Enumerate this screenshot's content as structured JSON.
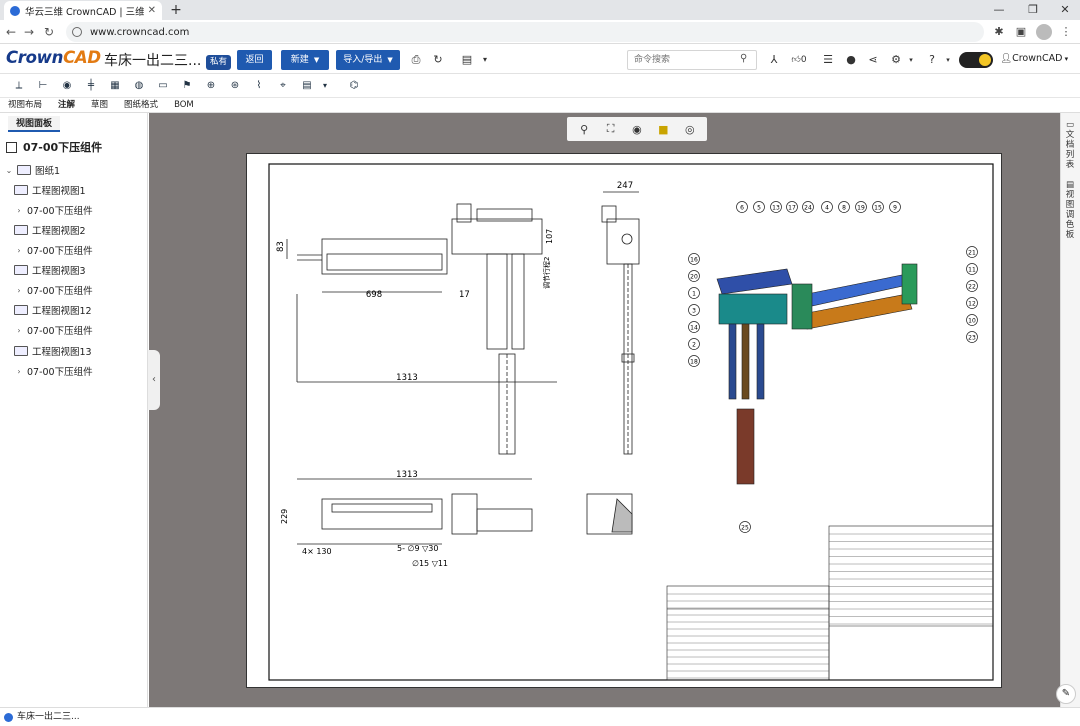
{
  "browser": {
    "tab_title": "华云三维 CrownCAD | 三维云CA",
    "url": "www.crowncad.com"
  },
  "header": {
    "logo_text": "Crown",
    "logo_accent": "CAD",
    "doc_name": "车床一出二三...",
    "private_badge": "私有",
    "buttons": {
      "back": "返回",
      "new": "新建",
      "import_export": "导入/导出"
    },
    "search_placeholder": "命令搜索",
    "like_count": "0",
    "user_name": "CrownCAD"
  },
  "menu_tabs": [
    "视图布局",
    "注解",
    "草图",
    "图纸格式",
    "BOM"
  ],
  "active_menu_tab": "注解",
  "left_panel": {
    "tab_label": "视图面板",
    "root": "07-00下压组件",
    "sheet": "图纸1",
    "views": [
      {
        "label": "工程图视图1",
        "child": "07-00下压组件"
      },
      {
        "label": "工程图视图2",
        "child": "07-00下压组件"
      },
      {
        "label": "工程图视图3",
        "child": "07-00下压组件"
      },
      {
        "label": "工程图视图12",
        "child": "07-00下压组件"
      },
      {
        "label": "工程图视图13",
        "child": "07-00下压组件"
      }
    ]
  },
  "right_bar": {
    "doc_list": "文档列表",
    "view_palette": "视图调色板"
  },
  "drawing": {
    "dim_247": "247",
    "dim_83": "83",
    "dim_698": "698",
    "dim_17": "17",
    "dim_107": "107",
    "dim_stroke": "调节行程2",
    "dim_1313a": "1313",
    "dim_1313b": "1313",
    "dim_229": "229",
    "dim_4x130": "4× 130",
    "hole_callout": "5- ∅9 ▽30",
    "hole_callout2": "∅15 ▽11",
    "balloons": [
      "6",
      "5",
      "13",
      "17",
      "24",
      "4",
      "8",
      "19",
      "15",
      "9",
      "16",
      "20",
      "1",
      "3",
      "14",
      "2",
      "18",
      "21",
      "11",
      "22",
      "12",
      "10",
      "23",
      "25"
    ]
  },
  "status": {
    "tab_preview": "车床一出二三..."
  }
}
